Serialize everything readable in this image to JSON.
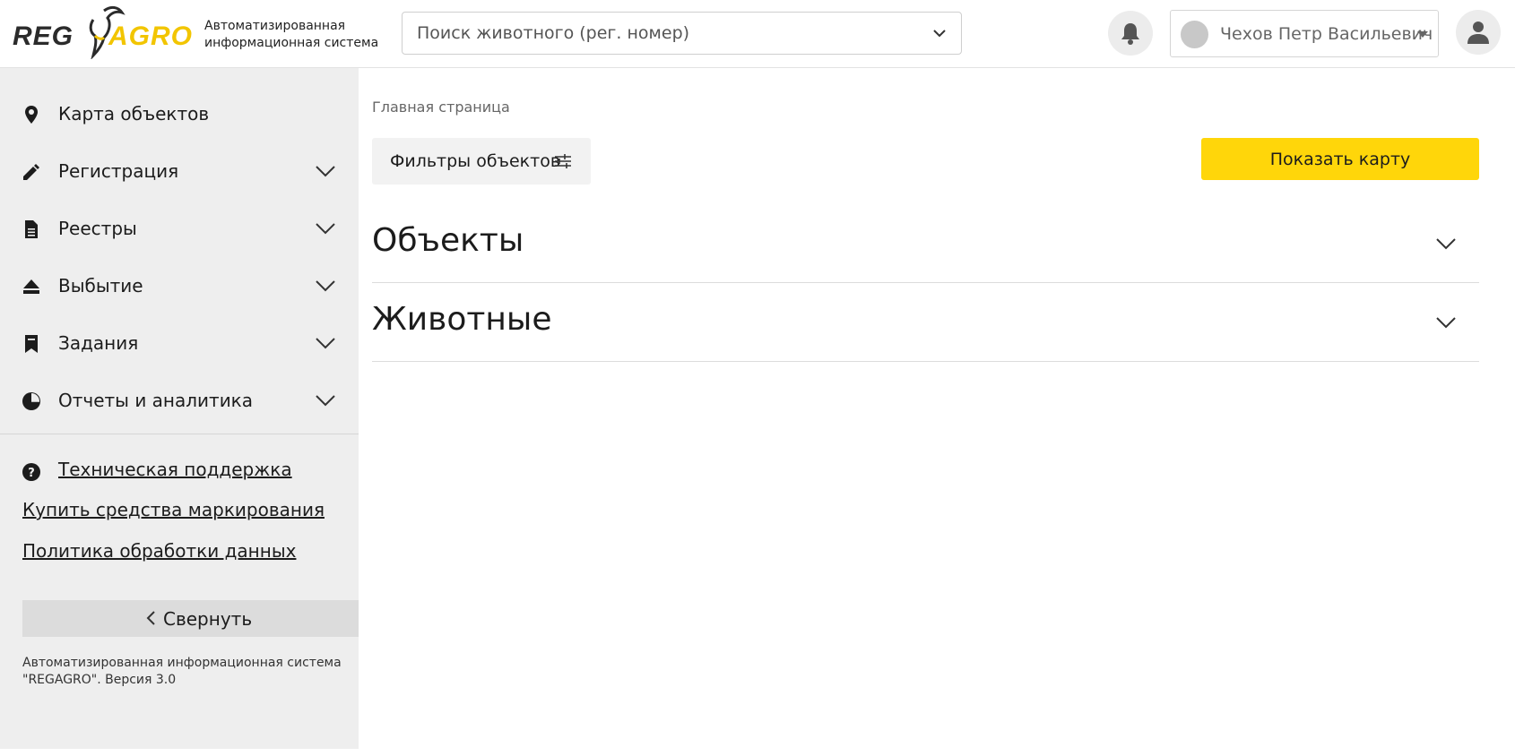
{
  "header": {
    "logo_left": "REG",
    "logo_right": "AGRO",
    "tagline_line1": "Автоматизированная",
    "tagline_line2": "информационная система",
    "search_placeholder": "Поиск животного (рег. номер)",
    "user_name": "Чехов Петр Васильевич"
  },
  "sidebar": {
    "items": [
      {
        "label": "Карта объектов",
        "icon": "map-pin-icon"
      },
      {
        "label": "Регистрация",
        "icon": "pencil-icon"
      },
      {
        "label": "Реестры",
        "icon": "document-icon"
      },
      {
        "label": "Выбытие",
        "icon": "eject-icon"
      },
      {
        "label": "Задания",
        "icon": "bookmark-icon"
      },
      {
        "label": "Отчеты и аналитика",
        "icon": "pie-chart-icon"
      }
    ],
    "support_link": "Техническая поддержка",
    "buy_link": "Купить средства маркирования",
    "policy_link": "Политика обработки данных",
    "collapse_label": "Свернуть",
    "footer_line1": "Автоматизированная информационная система",
    "footer_line2": "\"REGAGRO\". Версия 3.0"
  },
  "main": {
    "breadcrumb": "Главная страница",
    "filter_label": "Фильтры объектов",
    "show_map_label": "Показать карту",
    "sections": [
      {
        "title": "Объекты"
      },
      {
        "title": "Животные"
      }
    ]
  },
  "colors": {
    "accent": "#ffd60a",
    "brand_yellow": "#f2c500",
    "sidebar_bg": "#eeeeee"
  }
}
